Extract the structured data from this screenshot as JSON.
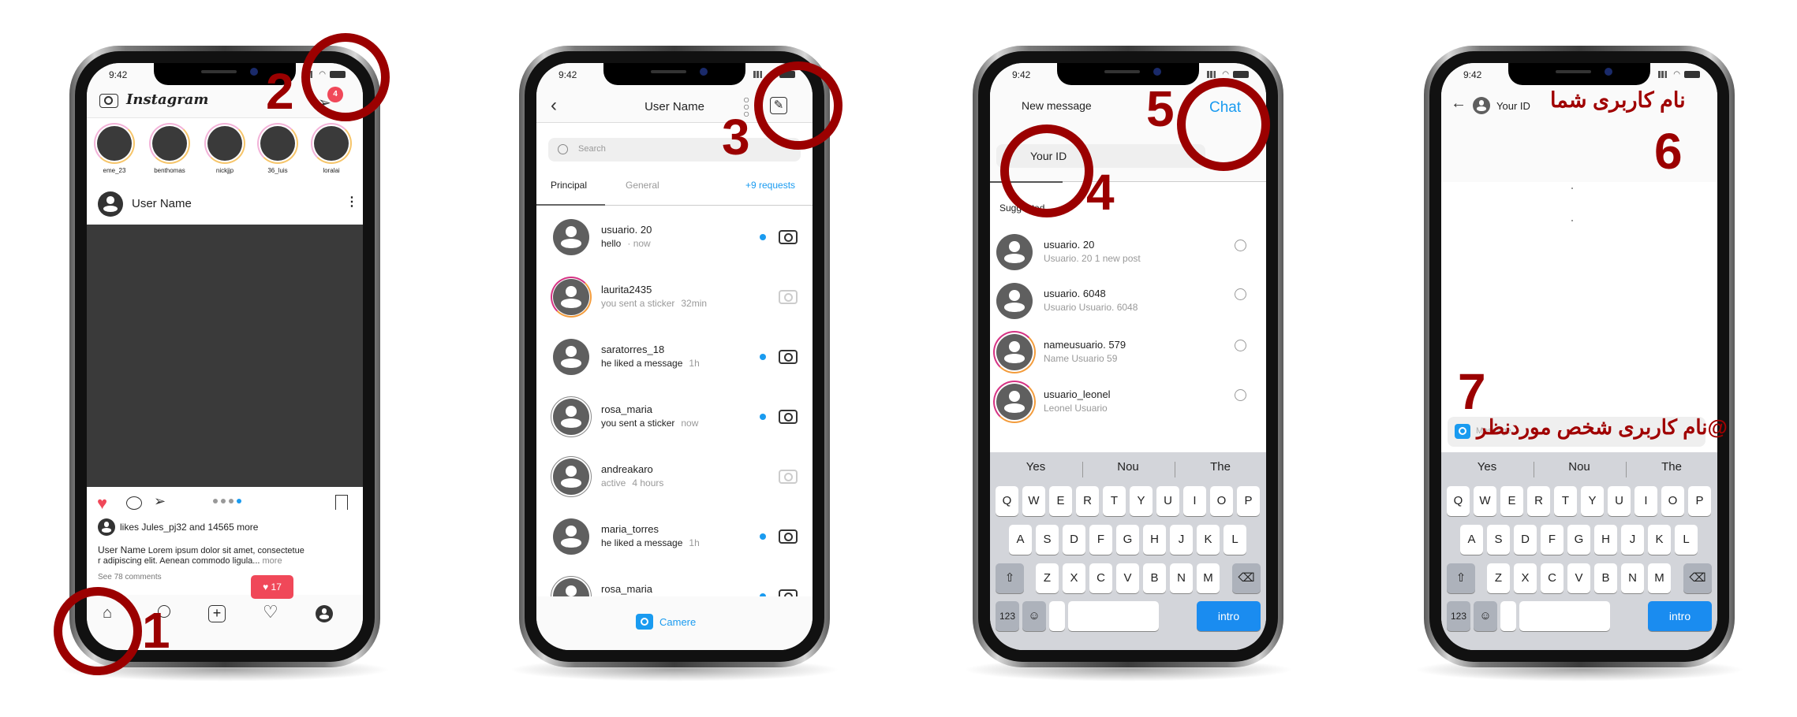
{
  "status_time": "9:42",
  "colors": {
    "annotation": "#9b0000",
    "accent_blue": "#1a9bf0",
    "like_red": "#f04859",
    "post_image": "#3a3a3a"
  },
  "annotations": {
    "n1": "1",
    "n2": "2",
    "n3": "3",
    "n4": "4",
    "n5": "5",
    "n6": "6",
    "n7": "7",
    "your_username": "نام کاربری شما",
    "target_username": "@نام کاربری شخص موردنظر"
  },
  "feed": {
    "logo": "Instagram",
    "dm_badge": "4",
    "stories": [
      "eme_23",
      "benthomas",
      "nickjjp",
      "36_luis",
      "loralai"
    ],
    "post_user": "User Name",
    "carousel_dots": 4,
    "likes_text": "likes Jules_pj32 and 14565 more",
    "caption_user": "User Name",
    "caption_line1": "Lorem ipsum dolor sit amet, consectetue",
    "caption_line2": "r adipiscing elit. Aenean commodo ligula...",
    "caption_more": "more",
    "comments": "See 78 comments",
    "notif_count": "17"
  },
  "inbox": {
    "title": "User Name",
    "search_placeholder": "Search",
    "tabs": [
      "Principal",
      "General"
    ],
    "requests": "+9 requests",
    "rows": [
      {
        "name": "usuario. 20",
        "msg": "hello",
        "time": "· now",
        "unread": true,
        "ring": "none",
        "cam_active": true
      },
      {
        "name": "laurita2435",
        "msg": "you sent a sticker",
        "time": "32min",
        "unread": false,
        "ring": "story",
        "cam_active": false
      },
      {
        "name": "saratorres_18",
        "msg": "he liked a message",
        "time": "1h",
        "unread": true,
        "ring": "none",
        "cam_active": true
      },
      {
        "name": "rosa_maria",
        "msg": "you sent a sticker",
        "time": "now",
        "unread": true,
        "ring": "seen",
        "cam_active": true
      },
      {
        "name": "andreakaro",
        "msg": "active",
        "time": "4 hours",
        "unread": false,
        "ring": "seen",
        "cam_active": false
      },
      {
        "name": "maria_torres",
        "msg": "he liked a message",
        "time": "1h",
        "unread": true,
        "ring": "none",
        "cam_active": true
      },
      {
        "name": "rosa_maria",
        "msg": "",
        "time": "",
        "unread": true,
        "ring": "seen",
        "cam_active": true
      }
    ],
    "camera_label": "Camere"
  },
  "new_message": {
    "title": "New message",
    "chat": "Chat",
    "to_value": "Your ID",
    "suggested": "Suggested",
    "rows": [
      {
        "name": "usuario. 20",
        "sub": "Usuario. 20   1 new post",
        "ring": "none"
      },
      {
        "name": "usuario. 6048",
        "sub": "Usuario Usuario. 6048",
        "ring": "none"
      },
      {
        "name": "nameusuario. 579",
        "sub": "Name Usuario 59",
        "ring": "story"
      },
      {
        "name": "usuario_leonel",
        "sub": "Leonel Usuario",
        "ring": "story"
      }
    ]
  },
  "chat": {
    "header_name": "Your ID",
    "message_placeholder": "Message"
  },
  "keyboard": {
    "suggestions": [
      "Yes",
      "Nou",
      "The"
    ],
    "row1": [
      "Q",
      "W",
      "E",
      "R",
      "T",
      "Y",
      "U",
      "I",
      "O",
      "P"
    ],
    "row2": [
      "A",
      "S",
      "D",
      "F",
      "G",
      "H",
      "J",
      "K",
      "L"
    ],
    "row3": [
      "Z",
      "X",
      "C",
      "V",
      "B",
      "N",
      "M"
    ],
    "shift": "⇧",
    "backspace": "⌫",
    "numbers": "123",
    "emoji": "☺",
    "enter": "intro"
  }
}
